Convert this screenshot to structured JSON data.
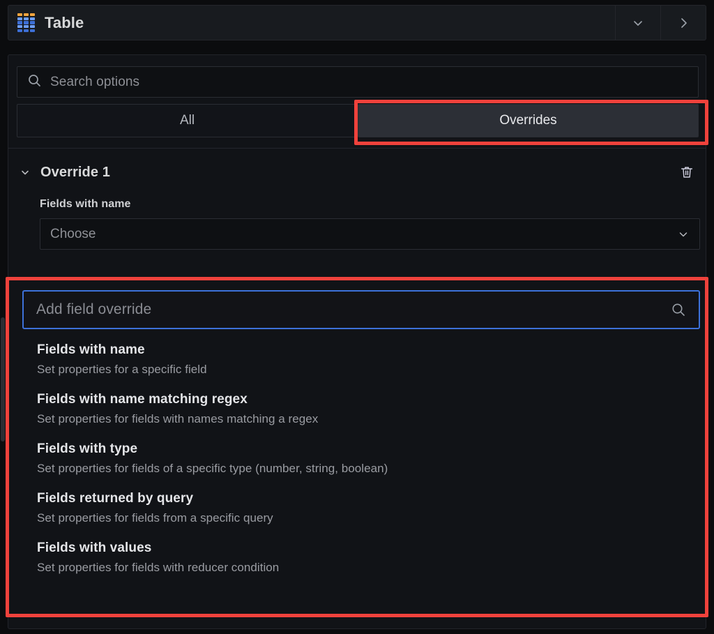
{
  "panel": {
    "title": "Table",
    "icon": "table-icon",
    "dropdown_icon": "chevron-down-icon",
    "expand_icon": "chevron-right-icon"
  },
  "search": {
    "placeholder": "Search options",
    "icon": "search-icon"
  },
  "tabs": [
    {
      "label": "All",
      "active": false
    },
    {
      "label": "Overrides",
      "active": true
    }
  ],
  "override": {
    "title": "Override 1",
    "collapse_icon": "chevron-down-icon",
    "delete_icon": "trash-icon",
    "field_label": "Fields with name",
    "select_value": "Choose",
    "select_icon": "chevron-down-icon"
  },
  "add_field_override": {
    "placeholder": "Add field override",
    "icon": "search-icon",
    "focused": true
  },
  "dropdown_options": [
    {
      "title": "Fields with name",
      "description": "Set properties for a specific field"
    },
    {
      "title": "Fields with name matching regex",
      "description": "Set properties for fields with names matching a regex"
    },
    {
      "title": "Fields with type",
      "description": "Set properties for fields of a specific type (number, string, boolean)"
    },
    {
      "title": "Fields returned by query",
      "description": "Set properties for fields from a specific query"
    },
    {
      "title": "Fields with values",
      "description": "Set properties for fields with reducer condition"
    }
  ],
  "annotations": {
    "highlight_color": "#f0423c",
    "focus_color": "#3d71d9"
  }
}
